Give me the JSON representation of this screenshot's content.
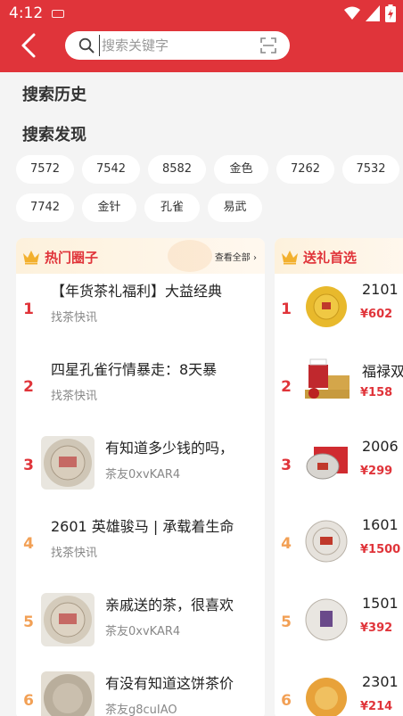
{
  "status_bar": {
    "time": "4:12"
  },
  "search": {
    "placeholder": "搜索关键字"
  },
  "history": {
    "title": "搜索历史"
  },
  "discover": {
    "title": "搜索发现",
    "chips": [
      "7572",
      "7542",
      "8582",
      "金色",
      "7262",
      "7532",
      "7742",
      "金针",
      "孔雀",
      "易武"
    ]
  },
  "hot_circle": {
    "title": "热门圈子",
    "more": "查看全部",
    "items": [
      {
        "rank": "1",
        "title": "【年货茶礼福利】大益经典",
        "author": "找茶快讯"
      },
      {
        "rank": "2",
        "title": "四星孔雀行情暴走：8天暴",
        "author": "找茶快讯"
      },
      {
        "rank": "3",
        "title": "有知道多少钱的吗，",
        "author": "茶友0xvKAR4"
      },
      {
        "rank": "4",
        "title": "2601 英雄骏马 | 承载着生命",
        "author": "找茶快讯"
      },
      {
        "rank": "5",
        "title": "亲戚送的茶，很喜欢",
        "author": "茶友0xvKAR4"
      },
      {
        "rank": "6",
        "title": "有没有知道这饼茶价",
        "author": "茶友g8cuIAO"
      }
    ]
  },
  "gift_pick": {
    "title": "送礼首选",
    "items": [
      {
        "rank": "1",
        "title": "2101",
        "price": "¥602"
      },
      {
        "rank": "2",
        "title": "福禄双",
        "price": "¥158"
      },
      {
        "rank": "3",
        "title": "2006",
        "price": "¥299"
      },
      {
        "rank": "4",
        "title": "1601",
        "price": "¥1500"
      },
      {
        "rank": "5",
        "title": "1501",
        "price": "¥392"
      },
      {
        "rank": "6",
        "title": "2301",
        "price": "¥214"
      }
    ]
  }
}
